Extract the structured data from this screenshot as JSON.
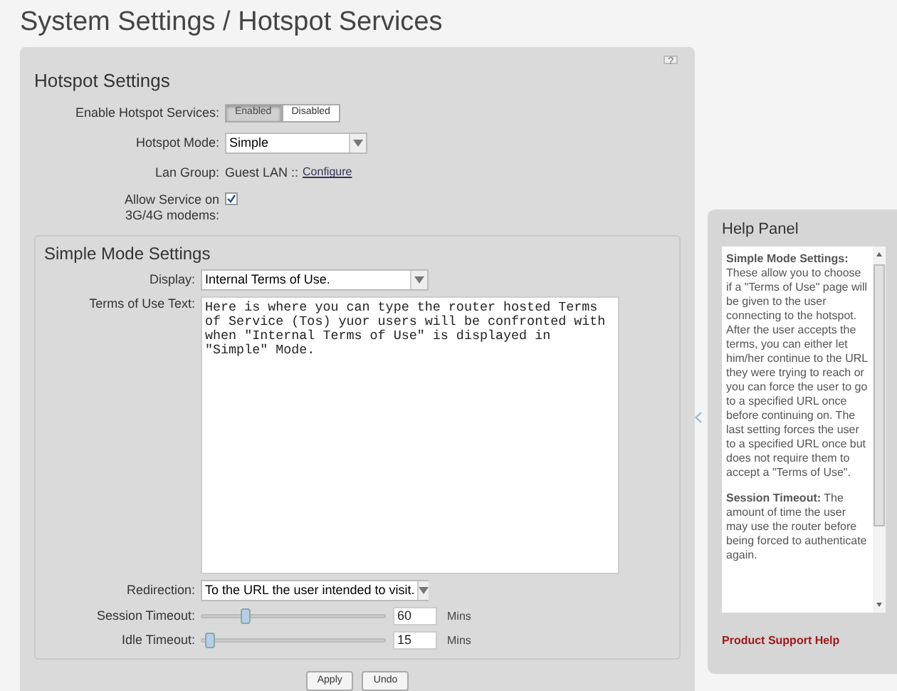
{
  "page_title": "System Settings / Hotspot Services",
  "hotspot_settings": {
    "title": "Hotspot Settings",
    "help_mark": "?",
    "enable_label": "Enable Hotspot Services:",
    "enable_options": [
      {
        "label": "Enabled",
        "selected": true
      },
      {
        "label": "Disabled",
        "selected": false
      }
    ],
    "mode_label": "Hotspot Mode:",
    "mode_value": "Simple",
    "lan_label": "Lan Group:",
    "lan_value": "Guest LAN ::",
    "lan_link": "Configure",
    "allow_label": "Allow Service on 3G/4G modems:",
    "allow_checked": true
  },
  "simple_mode": {
    "title": "Simple Mode Settings",
    "display_label": "Display:",
    "display_value": "Internal Terms of Use.",
    "terms_label": "Terms of Use Text:",
    "terms_value": "Here is where you can type the router hosted Terms of Service (Tos) yuor users will be confronted with when \"Internal Terms of Use\" is displayed in \"Simple\" Mode.",
    "redirection_label": "Redirection:",
    "redirection_value": "To the URL the user intended to visit.",
    "timeouts": [
      {
        "label": "Session Timeout:",
        "level": 0.22,
        "value": "60",
        "unit": "Mins"
      },
      {
        "label": "Idle Timeout:",
        "level": 0.02,
        "value": "15",
        "unit": "Mins"
      }
    ]
  },
  "buttons": [
    "Apply",
    "Undo"
  ],
  "help_panel": {
    "title": "Help Panel",
    "paragraphs": [
      "**Simple Mode Settings:** These allow you to choose if a \"Terms of Use\" page will be given to the user connecting to the hotspot. After the user accepts the terms, you can either let him/her continue to the URL they were trying to reach or you can force the user to go to a specified URL once before continuing on. The last setting forces the user to a specified URL once but does not require them to accept a \"Terms of Use\".",
      "**Session Timeout:** The amount of time the user may use the router before being forced to authenticate again."
    ],
    "link": "Product Support Help"
  }
}
